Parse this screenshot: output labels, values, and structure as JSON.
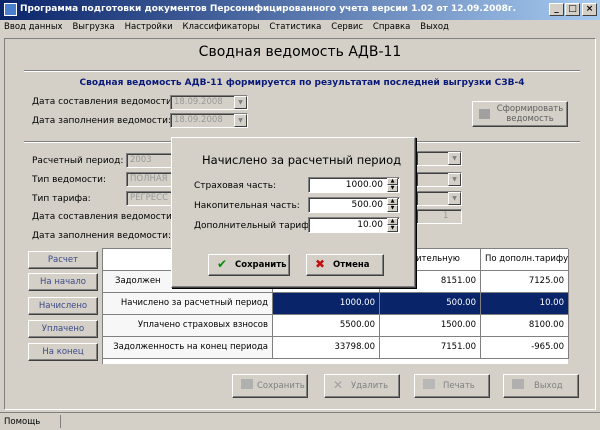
{
  "window": {
    "title": "Программа подготовки документов Персонифицированного учета версии 1.02 от 12.09.2008г.",
    "controls": [
      "_",
      "□",
      "×"
    ]
  },
  "menu": [
    "Ввод данных",
    "Выгрузка",
    "Настройки",
    "Классификаторы",
    "Статистика",
    "Сервис",
    "Справка",
    "Выход"
  ],
  "page": {
    "heading": "Сводная ведомость АДВ-11",
    "notice": "Сводная ведомость АДВ-11 формируется по результатам последней выгрузки СЗВ-4",
    "date_compiled_label": "Дата составления ведомости:",
    "date_compiled_value": "18.09.2008",
    "date_filled_label": "Дата заполнения ведомости:",
    "date_filled_value": "18.09.2008",
    "form_button": "Сформировать ведомость"
  },
  "form": {
    "period_label": "Расчетный период:",
    "period_value": "2003",
    "type_label": "Тип ведомости:",
    "type_value": "ПОЛНАЯ",
    "tariff_label": "Тип тарифа:",
    "tariff_value": "РЕГРЕСС",
    "date_compiled_label": "Дата составления ведомости:",
    "date_filled_label": "Дата заполнения ведомости:",
    "spin_value": "1"
  },
  "side_buttons": [
    "Расчет",
    "На начало",
    "Начислено",
    "Уплачено",
    "На конец"
  ],
  "table": {
    "headers": [
      "",
      "",
      "копительную",
      "По дополн.тарифу"
    ],
    "rows": [
      {
        "label": "Задолжен",
        "c1": "",
        "c2": "8151.00",
        "c3": "7125.00"
      },
      {
        "label": "Начислено за расчетный период",
        "c1": "1000.00",
        "c2": "500.00",
        "c3": "10.00"
      },
      {
        "label": "Уплачено страховых взносов",
        "c1": "5500.00",
        "c2": "1500.00",
        "c3": "8100.00"
      },
      {
        "label": "Задолженность на конец периода",
        "c1": "33798.00",
        "c2": "7151.00",
        "c3": "-965.00"
      }
    ]
  },
  "dialog": {
    "title": "Начислено за расчетный период",
    "fields": [
      {
        "label": "Страховая часть:",
        "value": "1000.00"
      },
      {
        "label": "Накопительная часть:",
        "value": "500.00"
      },
      {
        "label": "Дополнительный тариф:",
        "value": "10.00"
      }
    ],
    "save": "Сохранить",
    "cancel": "Отмена"
  },
  "footer_buttons": [
    "Сохранить",
    "Удалить",
    "Печать",
    "Выход"
  ],
  "status": "Помощь"
}
